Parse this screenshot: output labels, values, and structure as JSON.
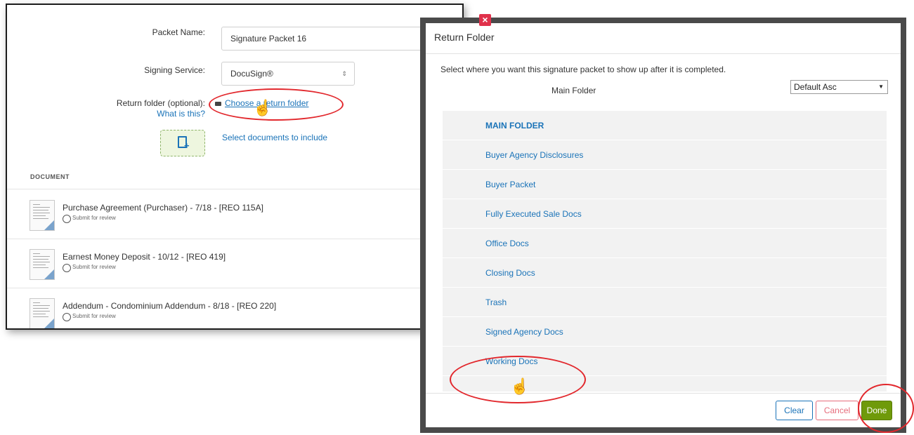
{
  "form": {
    "packet_name_label": "Packet Name:",
    "packet_name_value": "Signature Packet 16",
    "signing_service_label": "Signing Service:",
    "signing_service_value": "DocuSign®",
    "return_folder_label": "Return folder (optional):",
    "what_is_this": "What is this?",
    "choose_return_folder": "Choose a return folder",
    "select_documents": "Select documents to include",
    "document_header": "DOCUMENT",
    "documents": [
      {
        "title": "Purchase Agreement (Purchaser) - 7/18 - [REO 115A]",
        "radio_label": "Submit for review"
      },
      {
        "title": "Earnest Money Deposit - 10/12 - [REO 419]",
        "radio_label": "Submit for review"
      },
      {
        "title": "Addendum - Condominium Addendum - 8/18 - [REO 220]",
        "radio_label": "Submit for review"
      }
    ]
  },
  "modal": {
    "title": "Return Folder",
    "instruction": "Select where you want this signature packet to show up after it is completed.",
    "current_folder": "Main Folder",
    "sort_value": "Default Asc",
    "folders": [
      "MAIN FOLDER",
      "Buyer Agency Disclosures",
      "Buyer Packet",
      "Fully Executed Sale Docs",
      "Office Docs",
      "Closing Docs",
      "Trash",
      "Signed Agency Docs",
      "Working Docs"
    ],
    "buttons": {
      "clear": "Clear",
      "cancel": "Cancel",
      "done": "Done"
    },
    "close_symbol": "×"
  },
  "glyphs": {
    "plus": "+",
    "cursor": "☝",
    "sort_arrows": "⇕",
    "caret": "▼"
  },
  "colors": {
    "link": "#1a73b8",
    "done_green": "#6f9a0a",
    "annotation_red": "#e2282d",
    "close_red": "#e0314b"
  }
}
